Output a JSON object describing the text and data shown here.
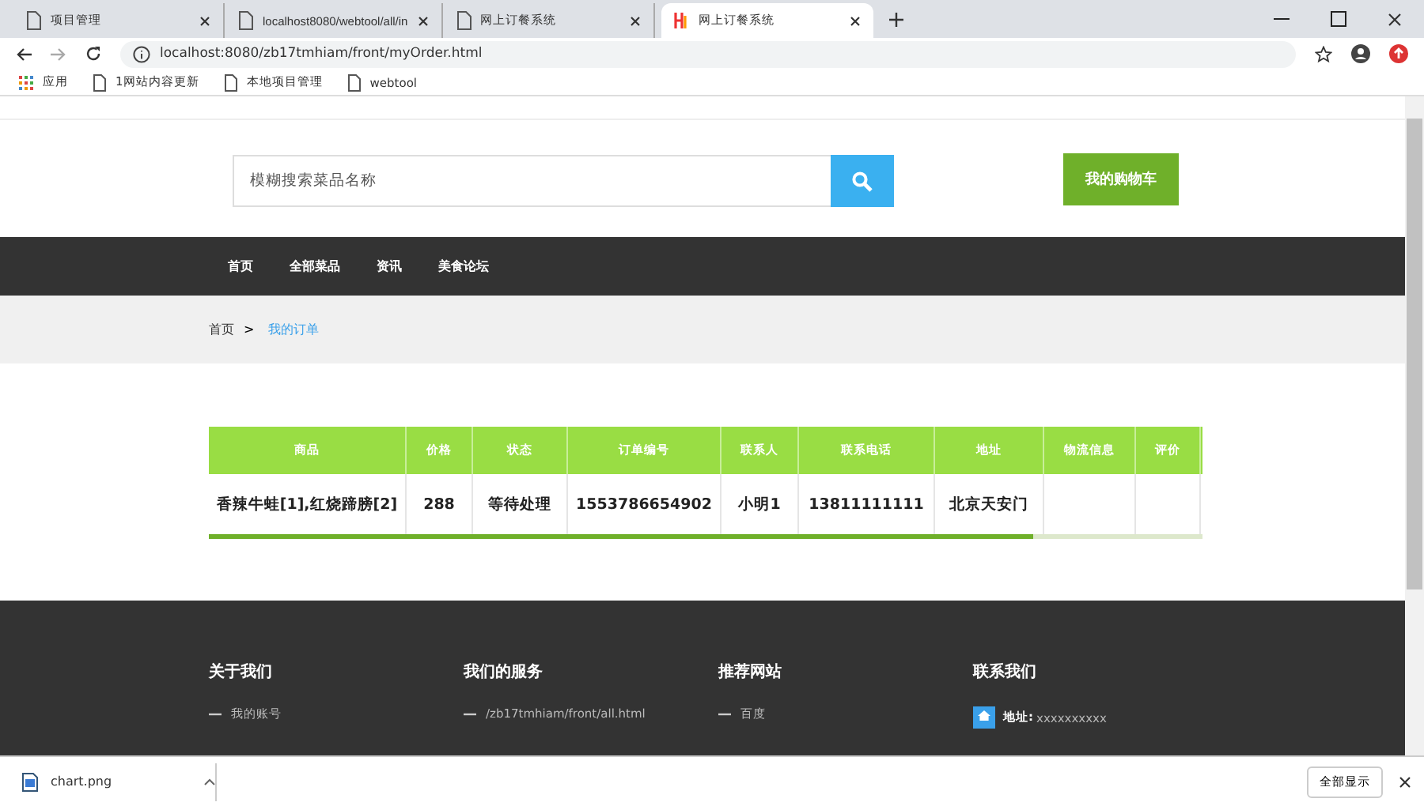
{
  "browser": {
    "tabs": [
      {
        "title": "项目管理",
        "selected": false
      },
      {
        "title": "localhost8080/webtool/all/in",
        "selected": false
      },
      {
        "title": "网上订餐系统",
        "selected": false
      },
      {
        "title": "网上订餐系统",
        "selected": true
      }
    ],
    "address": "localhost:8080/zb17tmhiam/front/myOrder.html",
    "bookmarks": [
      "应用",
      "1网站内容更新",
      "本地项目管理",
      "webtool"
    ]
  },
  "header": {
    "search": {
      "placeholder": "模糊搜索菜品名称"
    },
    "cart_button": "我的购物车"
  },
  "nav": [
    "首页",
    "全部菜品",
    "资讯",
    "美食论坛"
  ],
  "breadcrumb": {
    "home": "首页",
    "separator": ">",
    "current": "我的订单"
  },
  "table": {
    "columns": [
      "商品",
      "价格",
      "状态",
      "订单编号",
      "联系人",
      "联系电话",
      "地址",
      "物流信息",
      "评价"
    ],
    "rows": [
      [
        "香辣牛蛙[1],红烧蹄膀[2]",
        "288",
        "等待处理",
        "1553786654902",
        "小明1",
        "13811111111",
        "北京天安门",
        "",
        ""
      ]
    ]
  },
  "footer": [
    {
      "title": "关于我们",
      "items": [
        "我的账号"
      ],
      "kind": "list"
    },
    {
      "title": "我们的服务",
      "items": [
        "/zb17tmhiam/front/all.html"
      ],
      "kind": "list"
    },
    {
      "title": "推荐网站",
      "items": [
        "百度"
      ],
      "kind": "list"
    },
    {
      "title": "联系我们",
      "label": "地址:",
      "value": "xxxxxxxxxx",
      "kind": "contact"
    }
  ],
  "downloads": {
    "file": "chart.png",
    "show_all": "全部显示"
  }
}
